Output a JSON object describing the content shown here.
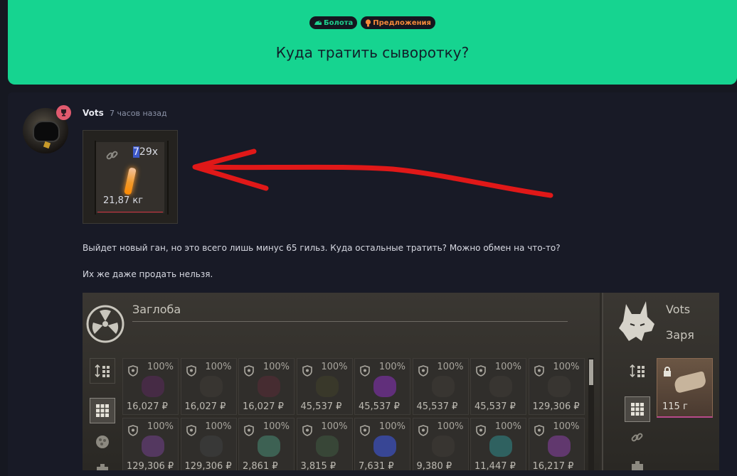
{
  "topic": {
    "tags": [
      {
        "label": "Болота",
        "icon": "swamp-icon",
        "color": "#1fd08f"
      },
      {
        "label": "Предложения",
        "icon": "lightbulb-icon",
        "color": "#f5893a"
      }
    ],
    "title": "Куда тратить сыворотку?"
  },
  "post": {
    "author": "Vots",
    "time": "7 часов назад",
    "item": {
      "count_prefix": "7",
      "count_highlight": "29x",
      "count_hl_prefix": "7",
      "count_rest": "29x",
      "weight": "21,87 кг"
    },
    "paragraphs": [
      "Выйдет новый ган, но это всего лишь минус 65 гильз. Куда остальные тратить? Можно обмен на что-то?",
      "Их же даже продать нельзя."
    ]
  },
  "screenshot": {
    "trader_name": "Заглоба",
    "player_name": "Vots",
    "player_faction": "Заря",
    "items": [
      {
        "pct": "100%",
        "price": "16,027 ₽",
        "color": "#4a2a4a"
      },
      {
        "pct": "100%",
        "price": "16,027 ₽",
        "color": "#3a3633"
      },
      {
        "pct": "100%",
        "price": "16,027 ₽",
        "color": "#4a2c33"
      },
      {
        "pct": "100%",
        "price": "45,537 ₽",
        "color": "#3b3a2a"
      },
      {
        "pct": "100%",
        "price": "45,537 ₽",
        "color": "#6a2f8a"
      },
      {
        "pct": "100%",
        "price": "45,537 ₽",
        "color": "#3a3633"
      },
      {
        "pct": "100%",
        "price": "45,537 ₽",
        "color": "#3a3633"
      },
      {
        "pct": "100%",
        "price": "129,306 ₽",
        "color": "#3a3633"
      },
      {
        "pct": "100%",
        "price": "129,306 ₽",
        "color": "#5a3a6a"
      },
      {
        "pct": "100%",
        "price": "129,306 ₽",
        "color": "#3a3a3a"
      },
      {
        "pct": "100%",
        "price": "2,861 ₽",
        "color": "#3f6a5a"
      },
      {
        "pct": "100%",
        "price": "3,815 ₽",
        "color": "#3a4a3a"
      },
      {
        "pct": "100%",
        "price": "7,631 ₽",
        "color": "#3a4aa8"
      },
      {
        "pct": "100%",
        "price": "9,380 ₽",
        "color": "#3a3633"
      },
      {
        "pct": "100%",
        "price": "11,447 ₽",
        "color": "#2f6a6a"
      },
      {
        "pct": "100%",
        "price": "16,217 ₽",
        "color": "#6a3a7a"
      }
    ],
    "player_item": {
      "price": "115 г"
    }
  }
}
